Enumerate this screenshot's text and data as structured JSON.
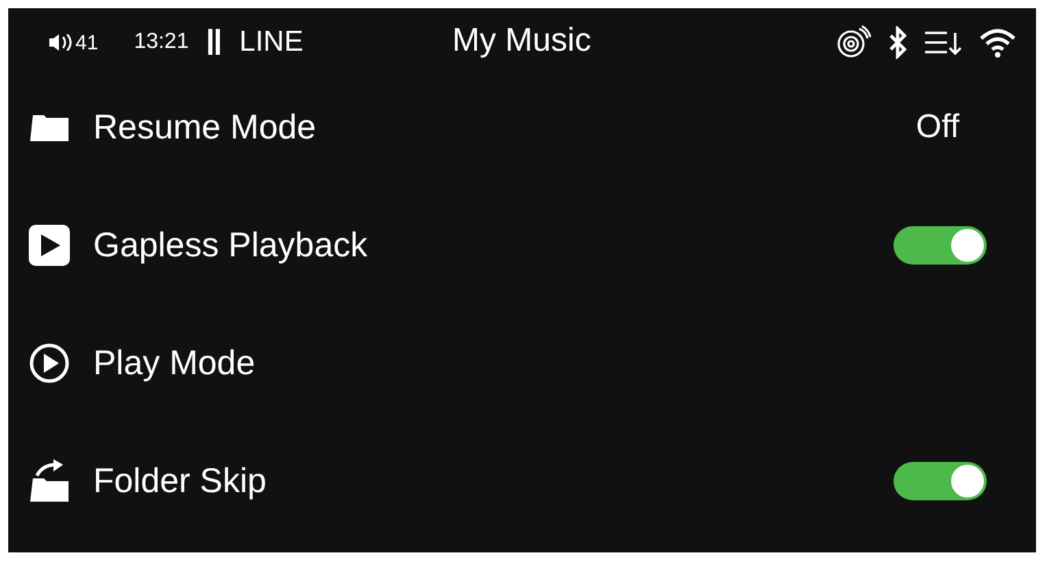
{
  "status_bar": {
    "volume": "41",
    "time": "13:21",
    "pause_symbol": "‖",
    "source": "LINE",
    "title": "My Music"
  },
  "settings": [
    {
      "label": "Resume Mode",
      "kind": "value",
      "value": "Off"
    },
    {
      "label": "Gapless Playback",
      "kind": "toggle",
      "on": true
    },
    {
      "label": "Play Mode",
      "kind": "plain"
    },
    {
      "label": "Folder Skip",
      "kind": "toggle",
      "on": true
    }
  ]
}
